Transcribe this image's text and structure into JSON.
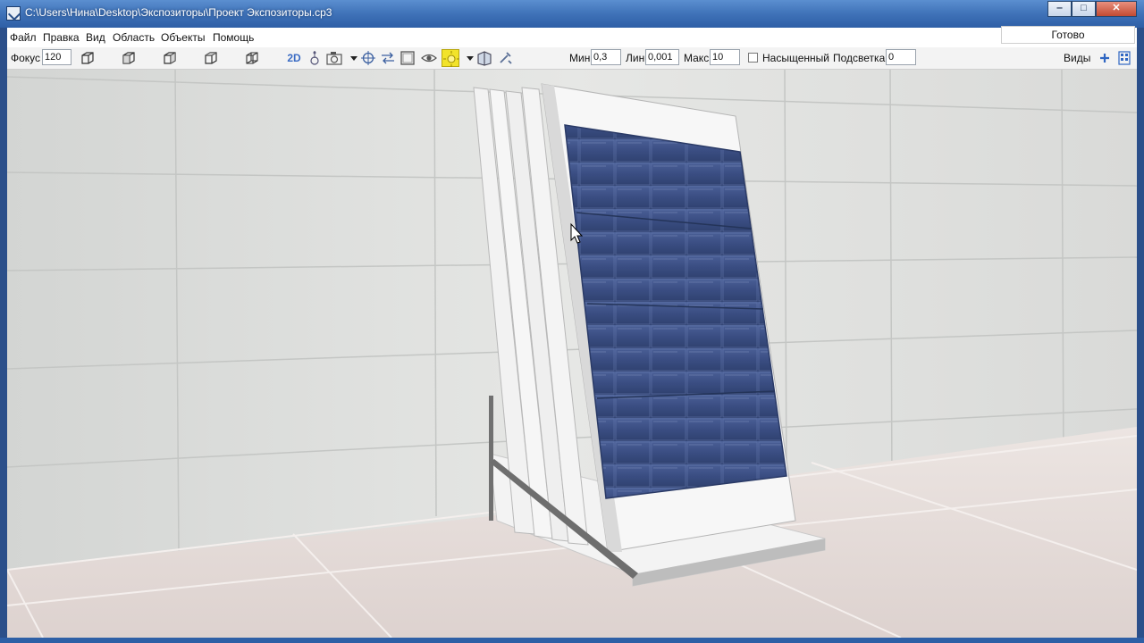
{
  "window": {
    "title": "C:\\Users\\Нина\\Desktop\\Экспозиторы\\Проект Экспозиторы.cp3",
    "minimize_glyph": "‒",
    "maximize_glyph": "□",
    "close_glyph": "✕"
  },
  "menu": {
    "items": [
      "Файл",
      "Правка",
      "Вид",
      "Область",
      "Объекты",
      "Помощь"
    ],
    "status": "Готово"
  },
  "toolbar": {
    "focus_label": "Фокус",
    "focus_value": "120",
    "view_cube_icons": [
      "cube-view-1-icon",
      "cube-view-2-icon",
      "cube-view-3-icon",
      "cube-view-4-icon",
      "cube-view-5-icon"
    ],
    "mode_2d_label": "2D",
    "tool_icons": [
      "pendulum-icon",
      "camera-icon",
      "dropdown-arrow-icon",
      "crosshair-icon",
      "swap-arrows-icon",
      "frame-icon",
      "eye-icon",
      "sun-icon",
      "dropdown-arrow-icon",
      "box-open-icon",
      "tools-icon"
    ],
    "min_label": "Мин",
    "min_value": "0,3",
    "lin_label": "Лин",
    "lin_value": "0,001",
    "max_label": "Макс",
    "max_value": "10",
    "saturated_label": "Насыщенный",
    "saturated_checked": false,
    "highlight_label": "Подсветка",
    "highlight_value": "0",
    "views_label": "Виды",
    "add_icon": "plus-icon",
    "views_icon": "views-panel-icon"
  },
  "colors": {
    "title_bar": "#3f72b8",
    "tile_blue": "#3c4f85",
    "wall": "#dedfdd",
    "floor": "#e6dcd9",
    "highlight_yellow": "#f2e32a"
  }
}
